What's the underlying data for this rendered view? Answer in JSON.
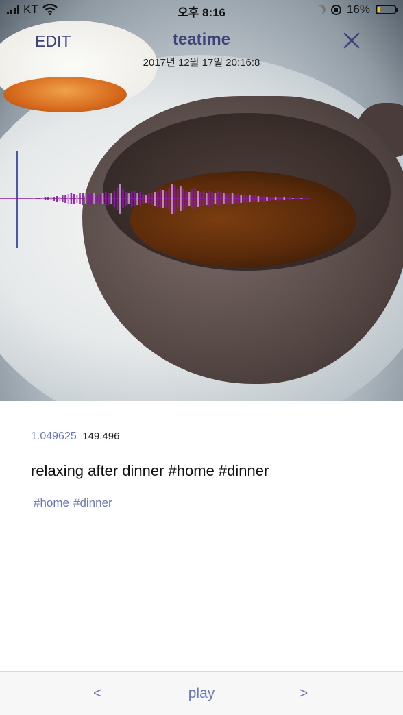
{
  "status_bar": {
    "carrier": "KT",
    "time": "오후 8:16",
    "battery": "16%",
    "battery_level": 0.16
  },
  "header": {
    "edit_label": "EDIT",
    "title": "teatime",
    "datetime": "2017년 12월 17일 20:16:8",
    "close_icon": "close-icon"
  },
  "colors": {
    "accent": "#3b4378",
    "link": "#6b78b4",
    "waveform_dark": "#8b1aa0",
    "waveform_light": "#c98fd6",
    "cursor": "#4b57a8"
  },
  "info": {
    "latitude": "1.049625",
    "longitude": "149.496",
    "caption": "relaxing after dinner #home #dinner",
    "tags": [
      "#home",
      "#dinner"
    ]
  },
  "bottom_bar": {
    "prev_label": "<",
    "play_label": "play",
    "next_label": ">"
  }
}
